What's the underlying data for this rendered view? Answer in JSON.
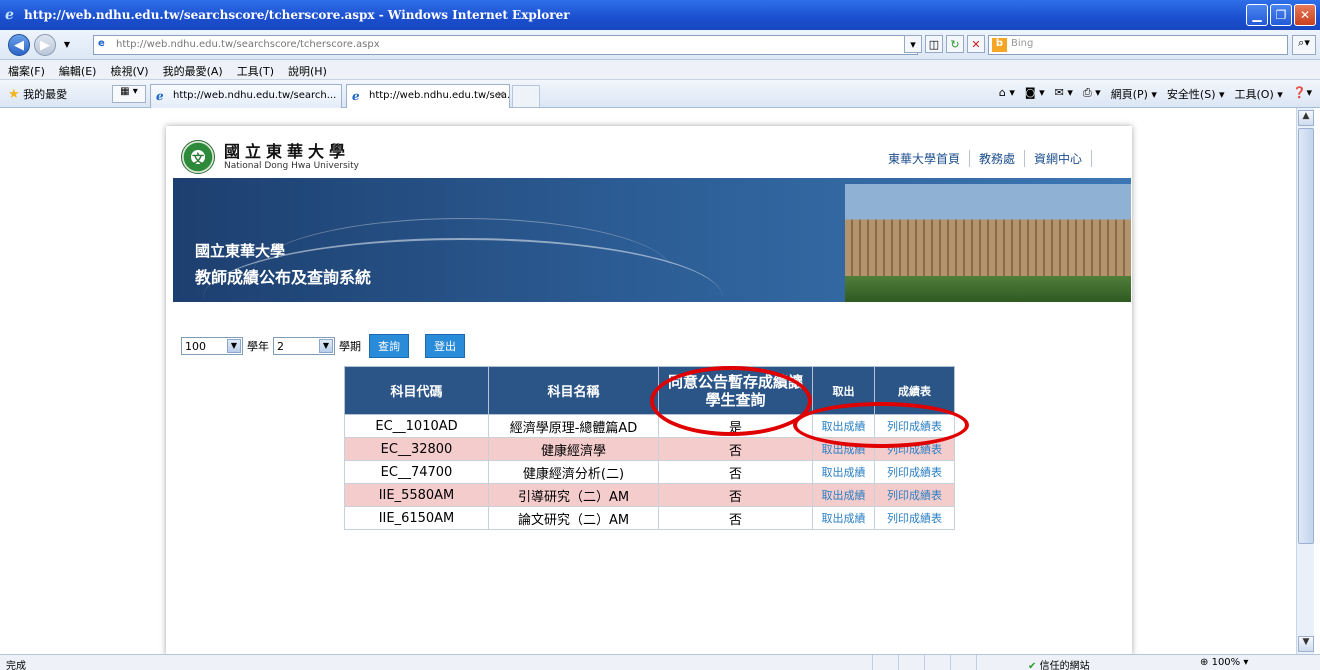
{
  "window": {
    "title": "http://web.ndhu.edu.tw/searchscore/tcherscore.aspx - Windows Internet Explorer",
    "minimize_glyph": "▁",
    "restore_glyph": "❐",
    "close_glyph": "✕"
  },
  "address": {
    "url": "http://web.ndhu.edu.tw/searchscore/tcherscore.aspx",
    "search_placeholder": "Bing"
  },
  "menu": [
    "檔案(F)",
    "編輯(E)",
    "檢視(V)",
    "我的最愛(A)",
    "工具(T)",
    "說明(H)"
  ],
  "favbar": {
    "favorites_label": "我的最愛",
    "tabs": [
      "http://web.ndhu.edu.tw/search...",
      "http://web.ndhu.edu.tw/sea..."
    ],
    "commands": [
      "網頁(P) ▾",
      "安全性(S) ▾",
      "工具(O) ▾"
    ]
  },
  "page": {
    "logo_cn": "國立東華大學",
    "logo_en": "National Dong Hwa University",
    "top_links": [
      "東華大學首頁",
      "教務處",
      "資網中心"
    ],
    "banner_line1": "國立東華大學",
    "banner_line2": "教師成績公布及查詢系統",
    "controls": {
      "year_value": "100",
      "year_label": "學年",
      "term_value": "2",
      "term_label": "學期",
      "query_button": "查詢",
      "logout_button": "登出"
    },
    "table": {
      "headers": [
        "科目代碼",
        "科目名稱",
        "同意公告暫存成績讓學生查詢",
        "取出",
        "成績表"
      ],
      "rows": [
        {
          "code": "EC__1010AD",
          "name": "經濟學原理-總體篇AD",
          "agree": "是",
          "fetch": "取出成績",
          "print": "列印成績表"
        },
        {
          "code": "EC__32800",
          "name": "健康經濟學",
          "agree": "否",
          "fetch": "取出成績",
          "print": "列印成績表"
        },
        {
          "code": "EC__74700",
          "name": "健康經濟分析(二)",
          "agree": "否",
          "fetch": "取出成績",
          "print": "列印成績表"
        },
        {
          "code": "IIE_5580AM",
          "name": "引導研究（二）AM",
          "agree": "否",
          "fetch": "取出成績",
          "print": "列印成績表"
        },
        {
          "code": "IIE_6150AM",
          "name": "論文研究（二）AM",
          "agree": "否",
          "fetch": "取出成績",
          "print": "列印成績表"
        }
      ]
    }
  },
  "status": {
    "left": "完成",
    "zone": "信任的網站",
    "zoom": "100%"
  },
  "colors": {
    "header_bg": "#2b5587",
    "row_alt": "#f4cccc",
    "link": "#2a7fc4",
    "annotation": "#e00000"
  }
}
